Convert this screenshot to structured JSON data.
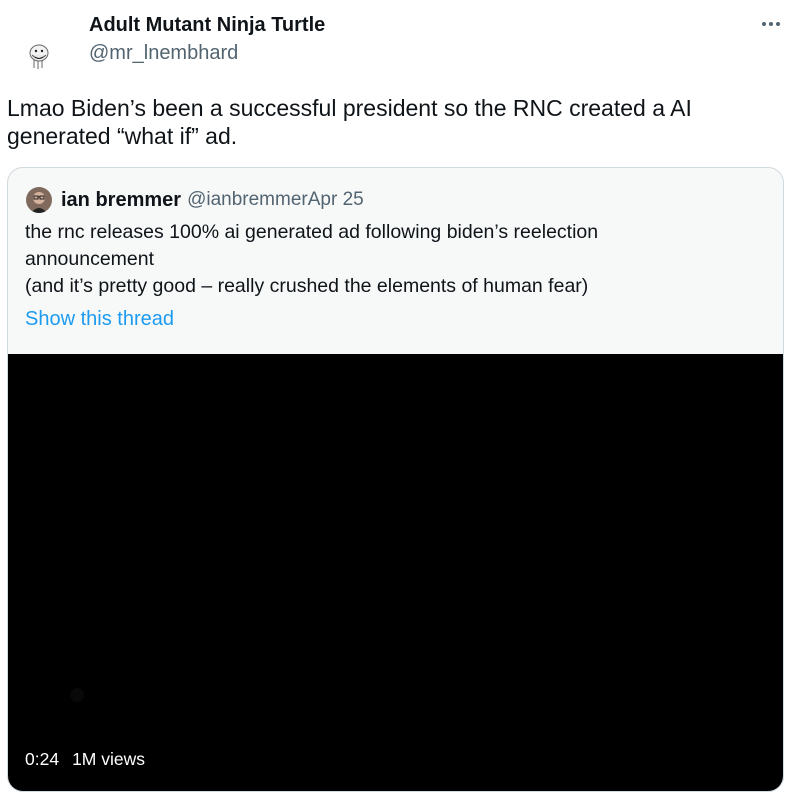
{
  "tweet": {
    "display_name": "Adult Mutant Ninja Turtle",
    "handle": "@mr_lnembhard",
    "text": "Lmao Biden’s been a successful president so the RNC created a AI generated “what if” ad.",
    "icons": {
      "avatar": "avatar-icon",
      "more": "more-horizontal-icon"
    }
  },
  "quote": {
    "display_name": "ian bremmer",
    "handle": "@ianbremmer",
    "date": "Apr 25",
    "text_lines": [
      "the rnc releases 100% ai generated ad following biden’s reelection",
      "announcement",
      "(and it’s pretty good – really crushed the elements of human fear)"
    ],
    "show_thread": "Show this thread",
    "video": {
      "duration": "0:24",
      "views": "1M views"
    }
  },
  "colors": {
    "text": "#0f1419",
    "secondary_text": "#536471",
    "link": "#1d9bf0",
    "card_background": "#f7f9f9",
    "border": "#cfd9de",
    "video_background": "#000000"
  }
}
